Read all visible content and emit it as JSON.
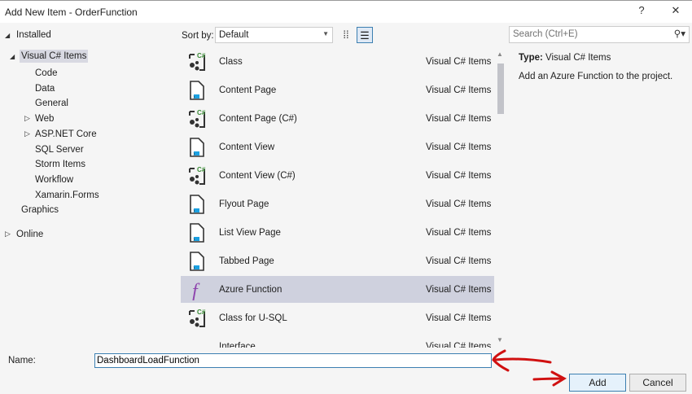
{
  "window": {
    "title": "Add New Item - OrderFunction",
    "help": "?",
    "close": "✕"
  },
  "tree": {
    "installed": "Installed",
    "visual_cs": "Visual C# Items",
    "children": [
      "Code",
      "Data",
      "General",
      "Web",
      "ASP.NET Core",
      "SQL Server",
      "Storm Items",
      "Workflow",
      "Xamarin.Forms"
    ],
    "graphics": "Graphics",
    "online": "Online"
  },
  "toolbar": {
    "sort_label": "Sort by:",
    "sort_value": "Default",
    "search_placeholder": "Search (Ctrl+E)"
  },
  "items": [
    {
      "name": "Class",
      "category": "Visual C# Items",
      "icon": "class"
    },
    {
      "name": "Content Page",
      "category": "Visual C# Items",
      "icon": "page"
    },
    {
      "name": "Content Page (C#)",
      "category": "Visual C# Items",
      "icon": "class"
    },
    {
      "name": "Content View",
      "category": "Visual C# Items",
      "icon": "page"
    },
    {
      "name": "Content View (C#)",
      "category": "Visual C# Items",
      "icon": "class"
    },
    {
      "name": "Flyout Page",
      "category": "Visual C# Items",
      "icon": "page"
    },
    {
      "name": "List View Page",
      "category": "Visual C# Items",
      "icon": "page"
    },
    {
      "name": "Tabbed Page",
      "category": "Visual C# Items",
      "icon": "page"
    },
    {
      "name": "Azure Function",
      "category": "Visual C# Items",
      "icon": "function",
      "selected": true
    },
    {
      "name": "Class for U-SQL",
      "category": "Visual C# Items",
      "icon": "class"
    },
    {
      "name": "Interface",
      "category": "Visual C# Items",
      "icon": "interface"
    }
  ],
  "details": {
    "type_label": "Type:",
    "type_value": "Visual C# Items",
    "description": "Add an Azure Function to the project."
  },
  "footer": {
    "name_label": "Name:",
    "name_value": "DashboardLoadFunction",
    "add": "Add",
    "cancel": "Cancel"
  },
  "colors": {
    "selected": "#cfd1de",
    "accent": "#3c7fb1",
    "annotation": "#d01010"
  }
}
